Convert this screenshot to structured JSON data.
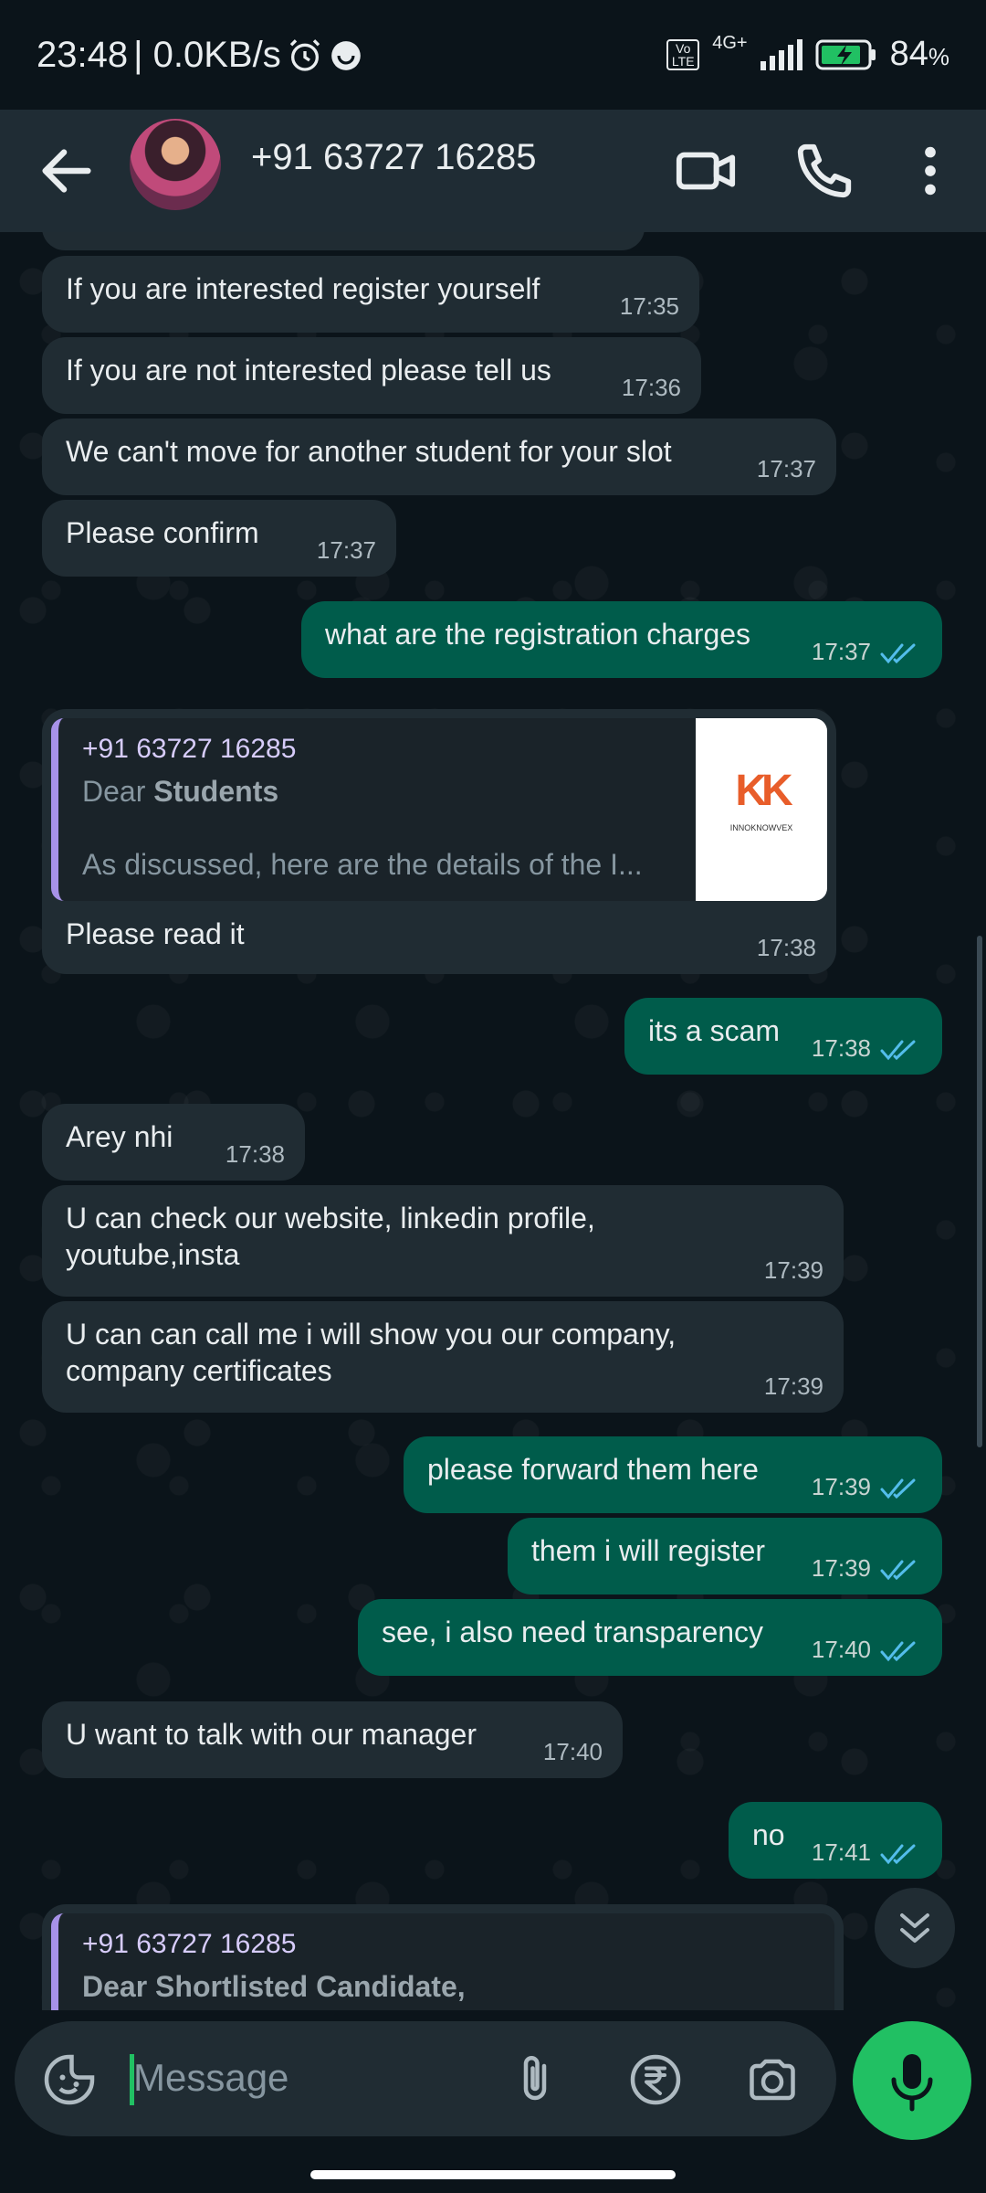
{
  "status_bar": {
    "time": "23:48",
    "speed": "| 0.0KB/s",
    "network": "4G+",
    "volte": "Vo LTE",
    "battery": "84",
    "battery_unit": "%"
  },
  "header": {
    "contact": "+91 63727 16285"
  },
  "messages": [
    {
      "dir": "in",
      "text": "If you are interested register yourself",
      "time": "17:35"
    },
    {
      "dir": "in",
      "text": "If you are not interested please tell us",
      "time": "17:36"
    },
    {
      "dir": "in",
      "text": "We can't move for another student for your slot",
      "time": "17:37"
    },
    {
      "dir": "in",
      "text": "Please confirm",
      "time": "17:37"
    },
    {
      "dir": "out",
      "text": "what are the registration charges",
      "time": "17:37"
    },
    {
      "dir": "in",
      "text": "Please read it",
      "time": "17:38",
      "quote": {
        "sender": "+91 63727 16285",
        "line1_prefix": "Dear ",
        "line1_bold": "Students",
        "line2": "As discussed, here are the details of the I...",
        "thumb_logo": "KK",
        "thumb_caption": "INNOKNOWVEX"
      }
    },
    {
      "dir": "out",
      "text": "its a scam",
      "time": "17:38"
    },
    {
      "dir": "in",
      "text": "Arey nhi",
      "time": "17:38"
    },
    {
      "dir": "in",
      "text": "U can check our website, linkedin profile, youtube,insta",
      "time": "17:39"
    },
    {
      "dir": "in",
      "text": "U can can call me i will show you our company, company certificates",
      "time": "17:39"
    },
    {
      "dir": "out",
      "text": "please forward them here",
      "time": "17:39"
    },
    {
      "dir": "out",
      "text": "them i will register",
      "time": "17:39"
    },
    {
      "dir": "out",
      "text": "see, i also need transparency",
      "time": "17:40"
    },
    {
      "dir": "in",
      "text": "U want to talk with our manager",
      "time": "17:40"
    },
    {
      "dir": "out",
      "text": "no",
      "time": "17:41"
    },
    {
      "dir": "in",
      "text": "",
      "time": "",
      "quote": {
        "sender": "+91 63727 16285",
        "line1_prefix": "",
        "line1_bold": "Dear Shortlisted Candidate,",
        "line2": ""
      }
    }
  ],
  "composer": {
    "placeholder": "Message"
  },
  "colors": {
    "accent": "#21c063",
    "outgoing_bubble": "#005c4b",
    "incoming_bubble": "#202c33",
    "tick": "#53bdeb"
  }
}
